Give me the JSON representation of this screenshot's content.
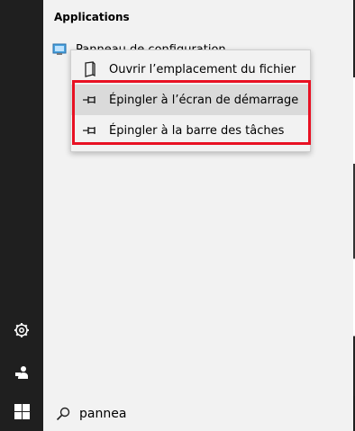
{
  "start_menu": {
    "section_title": "Applications",
    "app": {
      "label": "Panneau de configuration"
    }
  },
  "context_menu": {
    "items": [
      {
        "label": "Ouvrir l’emplacement du fichier",
        "icon": "folder-icon"
      },
      {
        "label": "Épingler à l’écran de démarrage",
        "icon": "pin-icon"
      },
      {
        "label": "Épingler à la barre des tâches",
        "icon": "pin-icon"
      }
    ]
  },
  "taskbar": {
    "search_value": "pannea"
  },
  "colors": {
    "highlight": "#e81123",
    "rail": "#1f1f1f",
    "menu_bg": "#f2f2f2",
    "hover_bg": "#dadada"
  }
}
